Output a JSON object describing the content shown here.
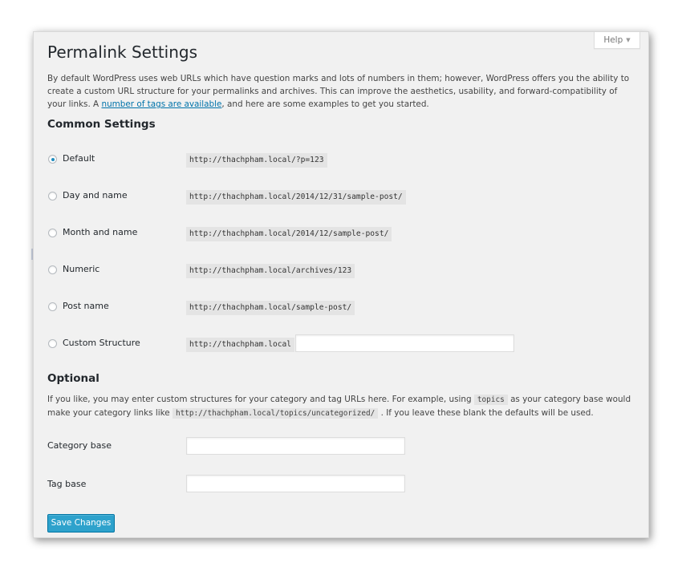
{
  "help": {
    "label": "Help"
  },
  "page": {
    "title": "Permalink Settings",
    "intro_text": "By default WordPress uses web URLs which have question marks and lots of numbers in them; however, WordPress offers you the ability to create a custom URL structure for your permalinks and archives. This can improve the aesthetics, usability, and forward-compatibility of your links. A ",
    "intro_link": "number of tags are available",
    "intro_text_end": ", and here are some examples to get you started."
  },
  "common": {
    "title": "Common Settings",
    "options": [
      {
        "label": "Default",
        "example": "http://thachpham.local/?p=123",
        "checked": true
      },
      {
        "label": "Day and name",
        "example": "http://thachpham.local/2014/12/31/sample-post/",
        "checked": false
      },
      {
        "label": "Month and name",
        "example": "http://thachpham.local/2014/12/sample-post/",
        "checked": false
      },
      {
        "label": "Numeric",
        "example": "http://thachpham.local/archives/123",
        "checked": false
      },
      {
        "label": "Post name",
        "example": "http://thachpham.local/sample-post/",
        "checked": false
      },
      {
        "label": "Custom Structure",
        "example": "http://thachpham.local",
        "checked": false,
        "value": ""
      }
    ]
  },
  "optional": {
    "title": "Optional",
    "text_1": "If you like, you may enter custom structures for your category and tag URLs here. For example, using ",
    "code_1": "topics",
    "text_2": " as your category base would make your category links like ",
    "code_2": "http://thachpham.local/topics/uncategorized/",
    "text_3": " . If you leave these blank the defaults will be used.",
    "category_base_label": "Category base",
    "category_base_value": "",
    "tag_base_label": "Tag base",
    "tag_base_value": ""
  },
  "actions": {
    "save_label": "Save Changes"
  },
  "colors": {
    "accent": "#2ea2cc",
    "link": "#0073aa",
    "panel_bg": "#f1f1f1"
  }
}
